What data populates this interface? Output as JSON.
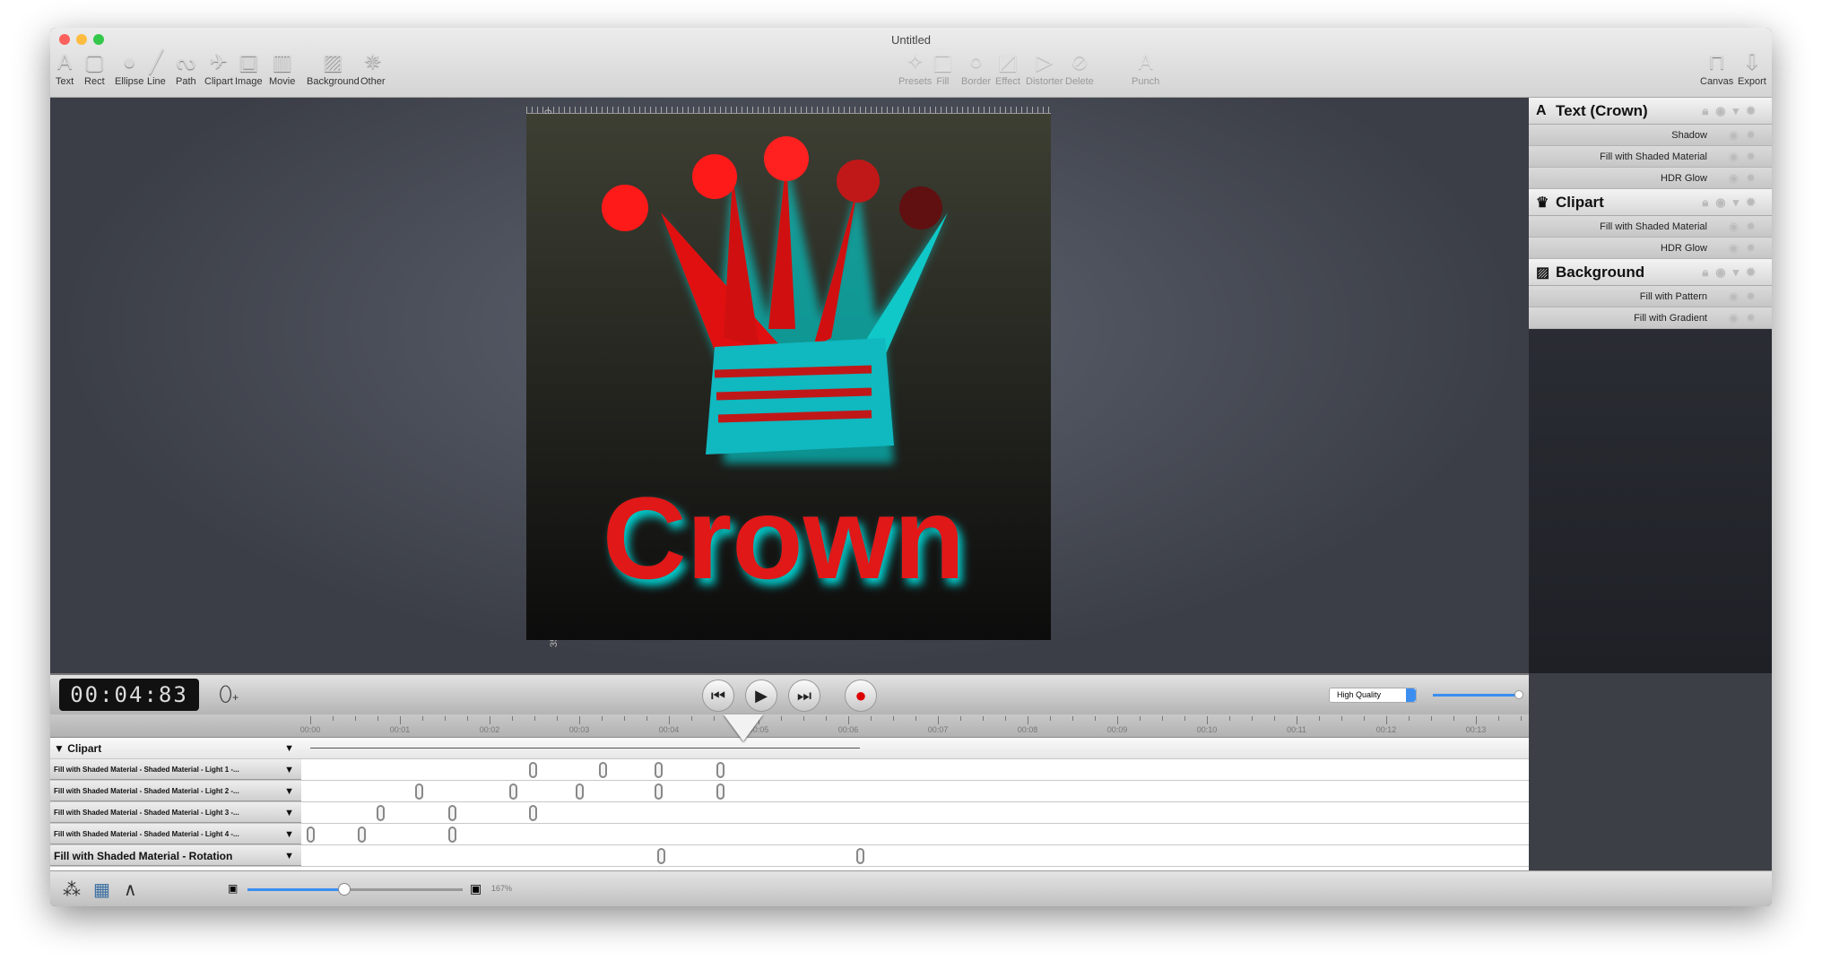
{
  "window": {
    "title": "Untitled"
  },
  "toolbar": {
    "left": [
      {
        "label": "Text",
        "icon": "text-icon",
        "glyph": "A"
      },
      {
        "label": "Rect",
        "icon": "rect-icon",
        "glyph": "▢"
      },
      {
        "label": "Ellipse",
        "icon": "ellipse-icon",
        "glyph": "●"
      },
      {
        "label": "Line",
        "icon": "line-icon",
        "glyph": "╱"
      },
      {
        "label": "Path",
        "icon": "path-icon",
        "glyph": "ᔓ"
      },
      {
        "label": "Clipart",
        "icon": "clipart-icon",
        "glyph": "✈"
      },
      {
        "label": "Image",
        "icon": "image-icon",
        "glyph": "▣"
      },
      {
        "label": "Movie",
        "icon": "movie-icon",
        "glyph": "▥"
      },
      {
        "label": "Background",
        "icon": "background-icon",
        "glyph": "▨"
      },
      {
        "label": "Other",
        "icon": "other-icon",
        "glyph": "✵"
      }
    ],
    "middle": [
      {
        "label": "Presets",
        "icon": "presets-icon",
        "glyph": "✧"
      },
      {
        "label": "Fill",
        "icon": "fill-icon",
        "glyph": "◪"
      },
      {
        "label": "Border",
        "icon": "border-icon",
        "glyph": "○"
      },
      {
        "label": "Effect",
        "icon": "effect-icon",
        "glyph": "◩"
      },
      {
        "label": "Distorter",
        "icon": "distorter-icon",
        "glyph": "▷"
      },
      {
        "label": "Delete",
        "icon": "delete-icon",
        "glyph": "⊘"
      },
      {
        "label": "Punch",
        "icon": "punch-icon",
        "glyph": "A"
      }
    ],
    "right": [
      {
        "label": "Canvas",
        "icon": "canvas-icon",
        "glyph": "⊓"
      },
      {
        "label": "Export",
        "icon": "export-icon",
        "glyph": "⇩"
      }
    ]
  },
  "canvas": {
    "ruler_labels": [
      "0",
      "50",
      "100",
      "150",
      "200",
      "250",
      "300",
      "350"
    ],
    "artwork_text": "Crown"
  },
  "layers": [
    {
      "name": "Text (Crown)",
      "icon": "text-layer-icon",
      "glyph": "A",
      "effects": [
        "Shadow",
        "Fill with Shaded Material",
        "HDR Glow"
      ]
    },
    {
      "name": "Clipart",
      "icon": "crown-icon",
      "glyph": "♛",
      "effects": [
        "Fill with Shaded Material",
        "HDR Glow"
      ]
    },
    {
      "name": "Background",
      "icon": "pattern-icon",
      "glyph": "▨",
      "effects": [
        "Fill with Pattern",
        "Fill with Gradient"
      ]
    }
  ],
  "playback": {
    "time": "00:04:83",
    "quality": "High Quality",
    "quality_slider": 1.0
  },
  "timeline": {
    "tick_labels": [
      "00:00",
      "00:01",
      "00:02",
      "00:03",
      "00:04",
      "00:05",
      "00:06",
      "00:07",
      "00:08",
      "00:09",
      "00:10",
      "00:11",
      "00:12",
      "00:13"
    ],
    "playhead_seconds": 4.83,
    "group": {
      "label": "Clipart",
      "start": 0,
      "end": 6.13
    },
    "tracks": [
      {
        "label": "Fill with Shaded Material - Shaded Material - Light 1 -...",
        "keys": [
          2.48,
          3.26,
          3.88,
          4.57
        ]
      },
      {
        "label": "Fill with Shaded Material - Shaded Material - Light 2 -...",
        "keys": [
          1.21,
          2.26,
          3.0,
          3.88,
          4.57
        ]
      },
      {
        "label": "Fill with Shaded Material - Shaded Material - Light 3 -...",
        "keys": [
          0.78,
          1.58,
          2.48
        ]
      },
      {
        "label": "Fill with Shaded Material - Shaded Material - Light 4 -...",
        "keys": [
          0,
          0.57,
          1.58
        ]
      },
      {
        "label": "Fill with Shaded Material - Rotation",
        "keys": [
          3.91,
          6.13
        ],
        "large": true
      }
    ]
  },
  "bottom": {
    "zoom": "167%",
    "zoom_slider": 0.45
  },
  "colors": {
    "accent": "#3b8ef0",
    "red": "#ff1a1a",
    "cyan": "#00e5e5"
  }
}
